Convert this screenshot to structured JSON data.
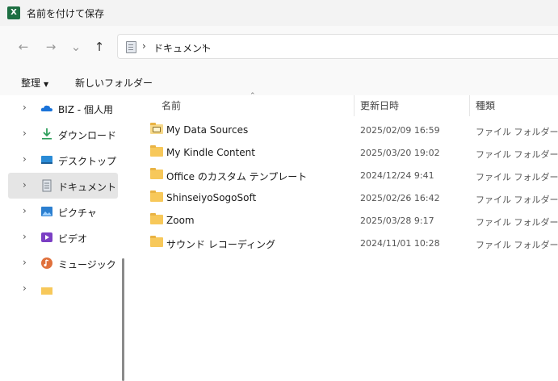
{
  "window": {
    "title": "名前を付けて保存",
    "app_icon_letter": "X",
    "app_color": "#1d6f42"
  },
  "nav_buttons": {
    "back": "←",
    "forward": "→",
    "recent": "⌄",
    "up": "↑"
  },
  "address": {
    "separator": "›",
    "crumb": "ドキュメント"
  },
  "toolbar": {
    "organize": "整理",
    "organize_caret": "▼",
    "new_folder": "新しいフォルダー"
  },
  "nav_pane": {
    "chevron": "›",
    "items": [
      {
        "label": "BIZ - 個人用",
        "icon": "onedrive-icon"
      },
      {
        "label": "ダウンロード",
        "icon": "download-icon"
      },
      {
        "label": "デスクトップ",
        "icon": "desktop-icon"
      },
      {
        "label": "ドキュメント",
        "icon": "documents-icon",
        "selected": true
      },
      {
        "label": "ピクチャ",
        "icon": "pictures-icon"
      },
      {
        "label": "ビデオ",
        "icon": "videos-icon"
      },
      {
        "label": "ミュージック",
        "icon": "music-icon"
      }
    ]
  },
  "file_list": {
    "columns": {
      "name": "名前",
      "modified": "更新日時",
      "type": "種類"
    },
    "sort_indicator": "⌃",
    "rows": [
      {
        "name": "My Data Sources",
        "modified": "2025/02/09 16:59",
        "type": "ファイル フォルダー",
        "icon": "special-folder-icon"
      },
      {
        "name": "My Kindle Content",
        "modified": "2025/03/20 19:02",
        "type": "ファイル フォルダー",
        "icon": "folder-icon"
      },
      {
        "name": "Office のカスタム テンプレート",
        "modified": "2024/12/24 9:41",
        "type": "ファイル フォルダー",
        "icon": "folder-icon"
      },
      {
        "name": "ShinseiyoSogoSoft",
        "modified": "2025/02/26 16:42",
        "type": "ファイル フォルダー",
        "icon": "folder-icon"
      },
      {
        "name": "Zoom",
        "modified": "2025/03/28 9:17",
        "type": "ファイル フォルダー",
        "icon": "folder-icon"
      },
      {
        "name": "サウンド レコーディング",
        "modified": "2024/11/01 10:28",
        "type": "ファイル フォルダー",
        "icon": "folder-icon"
      }
    ]
  }
}
